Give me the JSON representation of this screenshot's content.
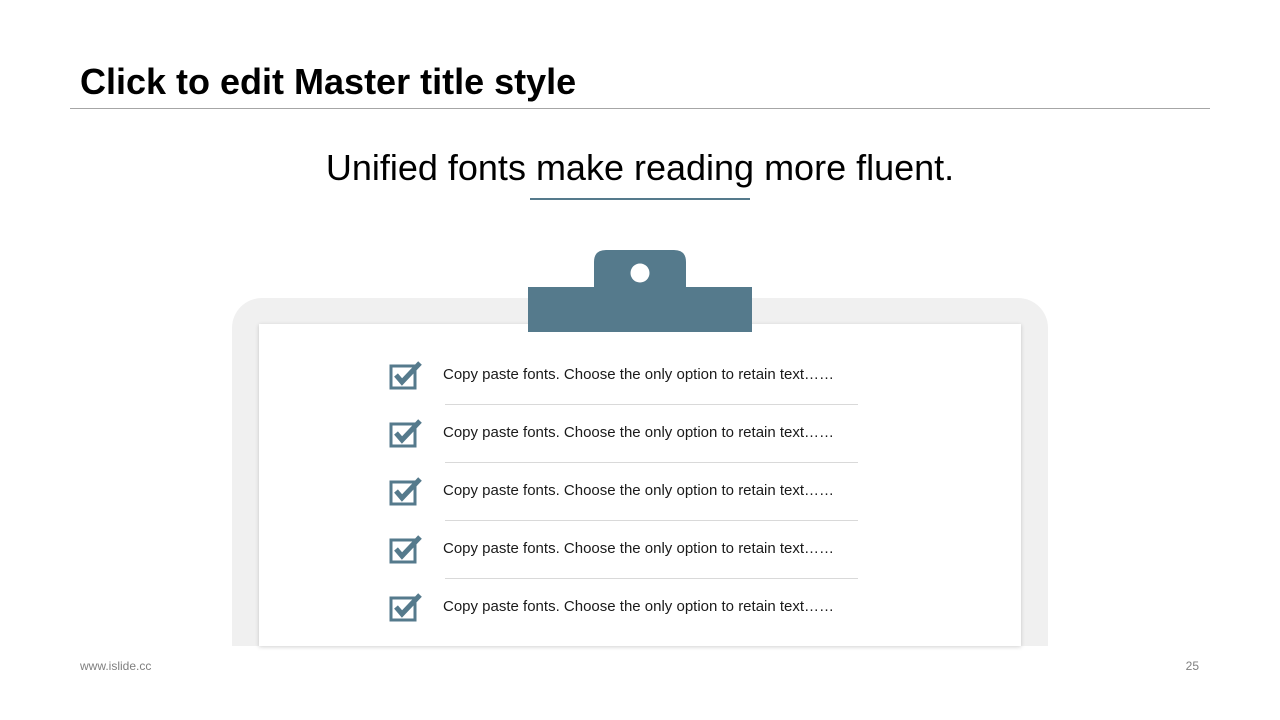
{
  "slide": {
    "title": "Click to edit Master title style",
    "subtitle": "Unified fonts make reading more fluent.",
    "footer_url": "www.islide.cc",
    "page_number": "25"
  },
  "checklist": {
    "items": [
      {
        "text": "Copy paste fonts. Choose the only option to retain text……",
        "checked": true
      },
      {
        "text": "Copy paste fonts. Choose the only option to retain text……",
        "checked": true
      },
      {
        "text": "Copy paste fonts. Choose the only option to retain text……",
        "checked": true
      },
      {
        "text": "Copy paste fonts. Choose the only option to retain text……",
        "checked": true
      },
      {
        "text": "Copy paste fonts. Choose the only option to retain text……",
        "checked": true
      }
    ],
    "icon": "checkbox-checked-icon"
  },
  "clipboard": {
    "icon": "clipboard-clip-icon"
  },
  "colors": {
    "accent": "#557a8c",
    "text": "#000000",
    "muted": "#7f7f7f",
    "board_back": "#f0f0f0",
    "divider": "#d9d9d9"
  }
}
